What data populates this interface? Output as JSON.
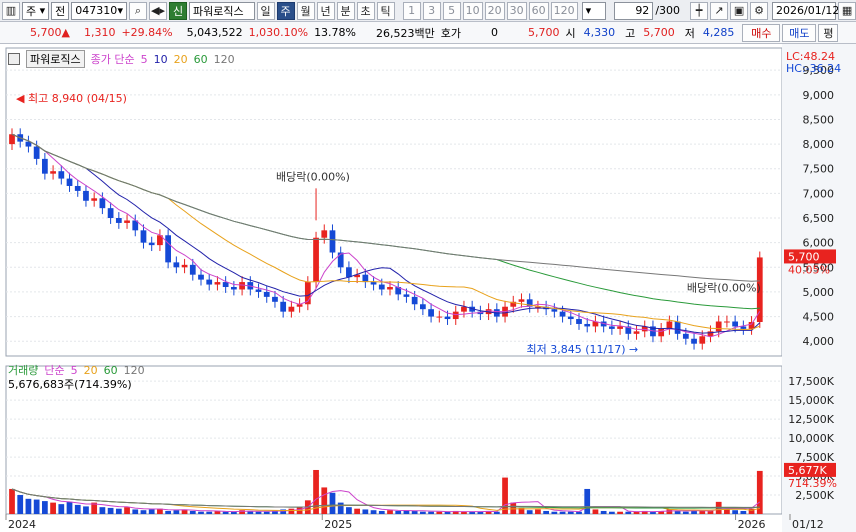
{
  "toolbar": {
    "market": "주",
    "type": "전",
    "code": "047310",
    "badge": "신",
    "name": "파워로직스",
    "periods": [
      "일",
      "주",
      "월",
      "년",
      "분",
      "초",
      "틱"
    ],
    "active_period": "주",
    "numbers": [
      "1",
      "3",
      "5",
      "10",
      "20",
      "30",
      "60",
      "120"
    ],
    "count": "92",
    "count_total": "/300",
    "date": "2026/01/12"
  },
  "quote": {
    "price": "5,700",
    "arrow": "▲",
    "change": "1,310",
    "pct": "+29.84%",
    "volume": "5,043,522",
    "vol_pct": "1,030.10%",
    "turnover": "13.78%",
    "amount": "26,523백만",
    "hoga_label": "호가",
    "hoga_value": "0",
    "price2": "5,700",
    "open_label": "시",
    "open": "4,330",
    "high_label": "고",
    "high": "5,700",
    "low_label": "저",
    "low": "4,285",
    "buy": "매수",
    "sell": "매도",
    "eval": "평"
  },
  "chart_data": {
    "type": "candlestick",
    "price_legend": {
      "title": "파워로직스",
      "series": [
        "종가 단순",
        "5",
        "10",
        "20",
        "60",
        "120"
      ]
    },
    "volume_legend": {
      "title": "거래량",
      "series": [
        "단순",
        "5",
        "20",
        "60",
        "120"
      ]
    },
    "price_yticks": [
      "9,500",
      "9,000",
      "8,500",
      "8,000",
      "7,500",
      "7,000",
      "6,500",
      "6,000",
      "5,500",
      "5,000",
      "4,500",
      "4,000"
    ],
    "price_ylim": [
      3700,
      9950
    ],
    "volume_yticks": [
      "17,500K",
      "15,000K",
      "12,500K",
      "10,000K",
      "7,500K",
      "5,000K",
      "2,500K"
    ],
    "volume_ylim": [
      0,
      19500
    ],
    "x_labels": [
      "2024",
      "2025",
      "2026",
      "01/12"
    ],
    "lc": "LC:48.24",
    "hc": "HC:-36.24",
    "last_price": "5,700",
    "last_pct": "40.05%",
    "last_volume": "5,677K",
    "last_vol_pct": "714.39%",
    "volume_note": "5,676,683주(714.39%)",
    "annotations": {
      "high": "최고 8,940 (04/15)",
      "low": "최저 3,845 (11/17)",
      "div1": "배당락(0.00%)",
      "div2": "배당락(0.00%)"
    },
    "colors": {
      "up": "#e8231f",
      "down": "#1549d6",
      "ma5": "#cc44cc",
      "ma10": "#2222aa",
      "ma20": "#e8a21c",
      "ma60": "#2a9a3a",
      "ma120": "#777777"
    },
    "closes": [
      8200,
      8050,
      7950,
      7700,
      7400,
      7450,
      7300,
      7150,
      7050,
      6850,
      6900,
      6700,
      6500,
      6400,
      6450,
      6250,
      6000,
      5950,
      6150,
      5600,
      5500,
      5550,
      5350,
      5250,
      5150,
      5200,
      5100,
      5050,
      5200,
      5050,
      5000,
      4900,
      4800,
      4600,
      4700,
      4750,
      5200,
      6100,
      6250,
      5800,
      5500,
      5300,
      5350,
      5200,
      5150,
      5050,
      5100,
      4950,
      4900,
      4750,
      4650,
      4500,
      4500,
      4450,
      4600,
      4700,
      4600,
      4550,
      4650,
      4500,
      4700,
      4800,
      4850,
      4700,
      4700,
      4650,
      4600,
      4500,
      4450,
      4350,
      4300,
      4400,
      4300,
      4250,
      4300,
      4150,
      4200,
      4300,
      4100,
      4250,
      4400,
      4150,
      4050,
      3950,
      4100,
      4200,
      4400,
      4400,
      4300,
      4250,
      4390,
      5700
    ],
    "volumes": [
      3300,
      2500,
      2000,
      1900,
      1700,
      1500,
      1300,
      1600,
      1200,
      1000,
      1500,
      900,
      800,
      700,
      900,
      600,
      500,
      600,
      700,
      400,
      500,
      600,
      400,
      300,
      300,
      400,
      300,
      300,
      500,
      400,
      300,
      300,
      400,
      600,
      700,
      900,
      1800,
      5800,
      3500,
      2800,
      1500,
      900,
      700,
      600,
      500,
      400,
      500,
      400,
      500,
      400,
      300,
      300,
      300,
      300,
      400,
      300,
      300,
      300,
      400,
      300,
      4800,
      1500,
      800,
      500,
      600,
      400,
      300,
      300,
      300,
      300,
      3300,
      600,
      400,
      300,
      300,
      300,
      300,
      400,
      300,
      400,
      600,
      400,
      300,
      400,
      500,
      400,
      1600,
      700,
      500,
      400,
      700,
      5677
    ]
  }
}
